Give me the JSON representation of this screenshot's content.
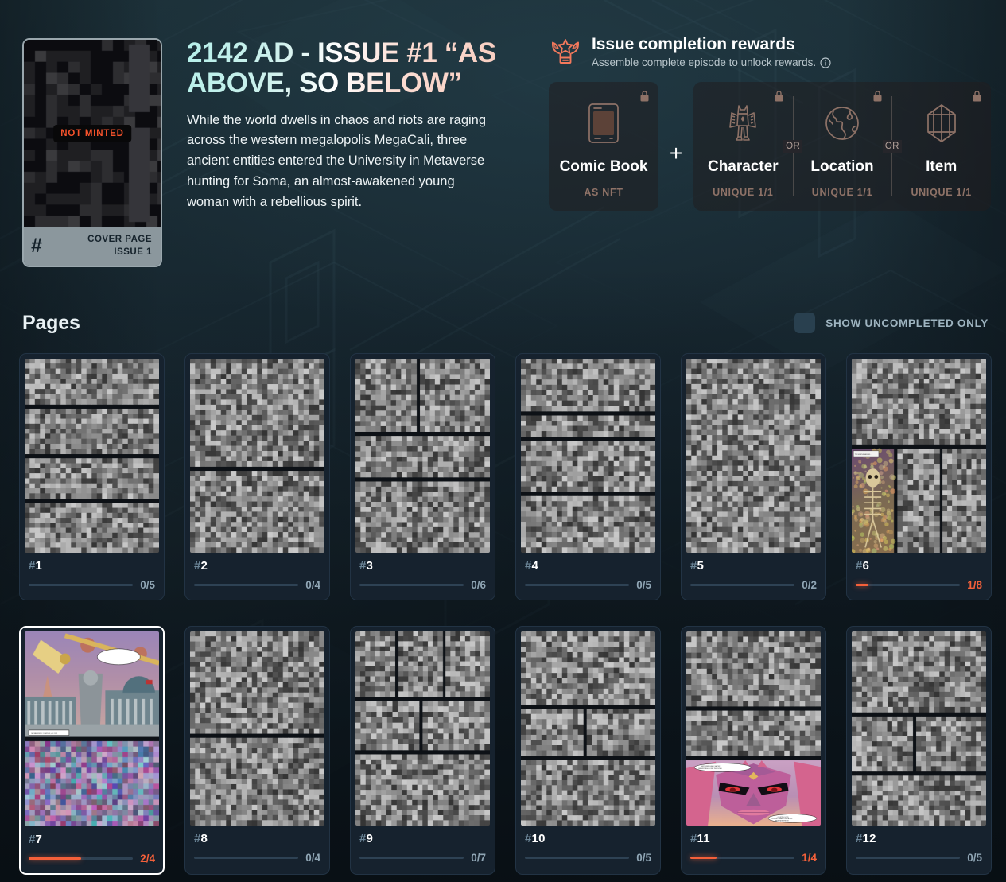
{
  "theme": {
    "bg": "#16252c",
    "card_bg": "#16222e",
    "accent_orange": "#f4603a",
    "accent_cyan": "#b6f0ea",
    "accent_pink": "#f8cdc0",
    "muted_text": "#8fa5b4",
    "lock_brown": "#8e7267"
  },
  "cover": {
    "badge": "NOT MINTED",
    "hash_symbol": "#",
    "label_line1": "COVER PAGE",
    "label_line2": "ISSUE 1",
    "minted": false
  },
  "hero": {
    "title": "2142 AD - Issue #1 “As above, so below”",
    "description": "While the world dwells in chaos and riots are raging across the western megalopolis MegaCali, three ancient entities entered the University in Metaverse hunting for Soma, an almost-awakened young woman with a rebellious spirit."
  },
  "rewards": {
    "icon": "trophy-icon",
    "title": "Issue completion rewards",
    "subtitle": "Assemble complete episode to unlock rewards.",
    "info_icon": "info-icon",
    "plus_symbol": "+",
    "or_label": "OR",
    "primary": {
      "icon": "comic-book-icon",
      "name": "Comic Book",
      "tag": "AS NFT",
      "locked": true,
      "lock_icon": "lock-icon"
    },
    "alternatives": [
      {
        "icon": "character-icon",
        "name": "Character",
        "tag": "UNIQUE 1/1",
        "locked": true,
        "lock_icon": "lock-icon"
      },
      {
        "icon": "globe-icon",
        "name": "Location",
        "tag": "UNIQUE 1/1",
        "locked": true,
        "lock_icon": "lock-icon"
      },
      {
        "icon": "gem-icon",
        "name": "Item",
        "tag": "UNIQUE 1/1",
        "locked": true,
        "lock_icon": "lock-icon"
      }
    ]
  },
  "pages_section": {
    "heading": "Pages",
    "filter": {
      "label": "SHOW UNCOMPLETED ONLY",
      "checked": false
    }
  },
  "pages": [
    {
      "hash": "#",
      "number": "1",
      "count": "0/5",
      "owned": 0,
      "total": 5,
      "highlighted": false,
      "revealed_panel": null
    },
    {
      "hash": "#",
      "number": "2",
      "count": "0/4",
      "owned": 0,
      "total": 4,
      "highlighted": false,
      "revealed_panel": null
    },
    {
      "hash": "#",
      "number": "3",
      "count": "0/6",
      "owned": 0,
      "total": 6,
      "highlighted": false,
      "revealed_panel": null
    },
    {
      "hash": "#",
      "number": "4",
      "count": "0/5",
      "owned": 0,
      "total": 5,
      "highlighted": false,
      "revealed_panel": null
    },
    {
      "hash": "#",
      "number": "5",
      "count": "0/2",
      "owned": 0,
      "total": 2,
      "highlighted": false,
      "revealed_panel": null
    },
    {
      "hash": "#",
      "number": "6",
      "count": "1/8",
      "owned": 1,
      "total": 8,
      "highlighted": false,
      "revealed_panel": "skeleton"
    },
    {
      "hash": "#",
      "number": "7",
      "count": "2/4",
      "owned": 2,
      "total": 4,
      "highlighted": true,
      "revealed_panel": "cityscape"
    },
    {
      "hash": "#",
      "number": "8",
      "count": "0/4",
      "owned": 0,
      "total": 4,
      "highlighted": false,
      "revealed_panel": null
    },
    {
      "hash": "#",
      "number": "9",
      "count": "0/7",
      "owned": 0,
      "total": 7,
      "highlighted": false,
      "revealed_panel": null
    },
    {
      "hash": "#",
      "number": "10",
      "count": "0/5",
      "owned": 0,
      "total": 5,
      "highlighted": false,
      "revealed_panel": null
    },
    {
      "hash": "#",
      "number": "11",
      "count": "1/4",
      "owned": 1,
      "total": 4,
      "highlighted": false,
      "revealed_panel": "alienface"
    },
    {
      "hash": "#",
      "number": "12",
      "count": "0/5",
      "owned": 0,
      "total": 5,
      "highlighted": false,
      "revealed_panel": null
    }
  ]
}
